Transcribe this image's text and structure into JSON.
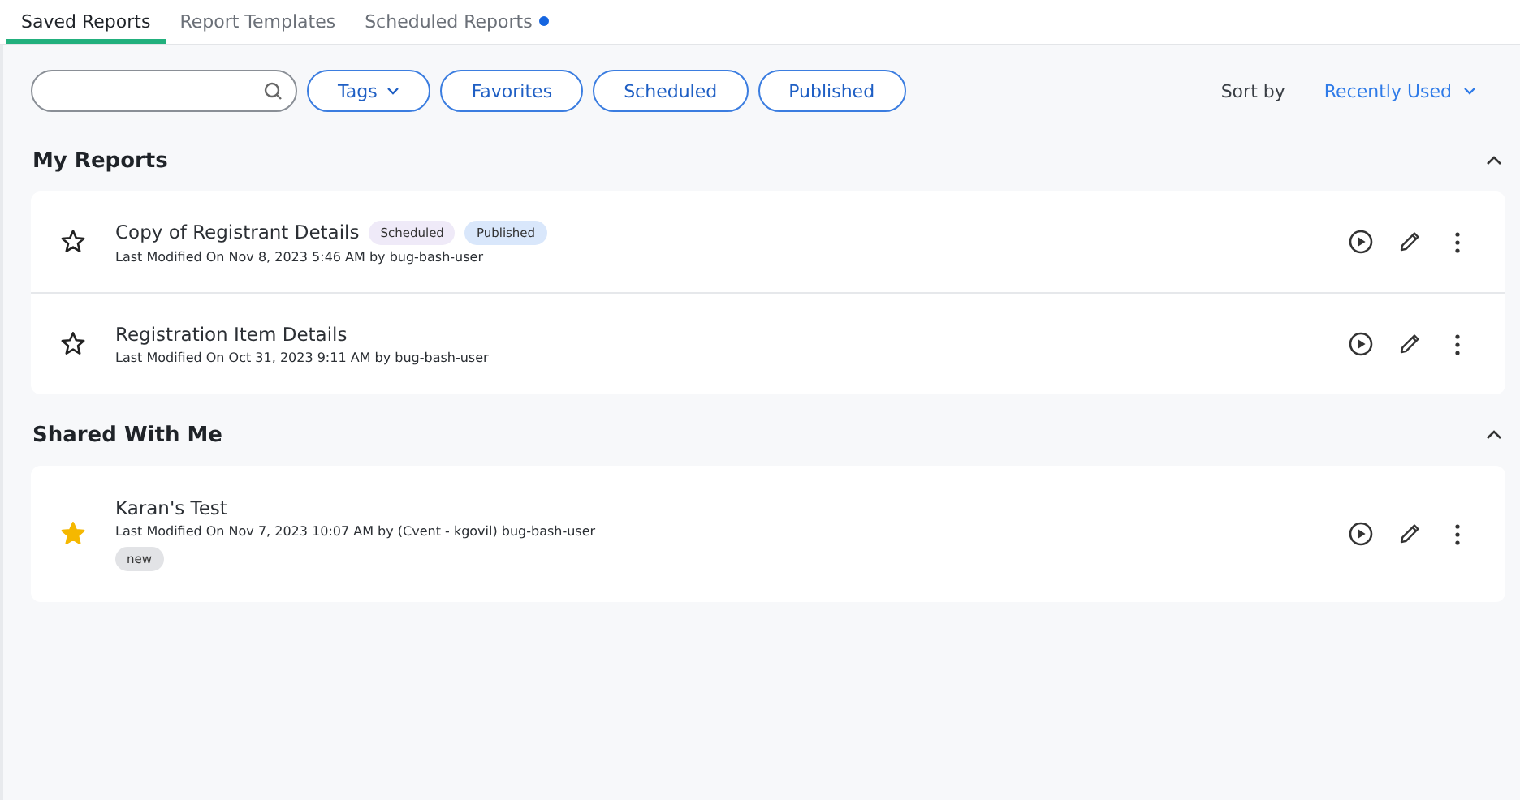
{
  "tabs": [
    {
      "label": "Saved Reports",
      "selected": true,
      "notification": false
    },
    {
      "label": "Report Templates",
      "selected": false,
      "notification": false
    },
    {
      "label": "Scheduled Reports",
      "selected": false,
      "notification": true
    }
  ],
  "filters": {
    "chips": [
      {
        "label": "Tags",
        "dropdown": true
      },
      {
        "label": "Favorites",
        "dropdown": false
      },
      {
        "label": "Scheduled",
        "dropdown": false
      },
      {
        "label": "Published",
        "dropdown": false
      }
    ],
    "sort_label": "Sort by",
    "sort_value": "Recently Used"
  },
  "sections": [
    {
      "title": "My Reports",
      "expanded": true,
      "reports": [
        {
          "name": "Copy of Registrant Details",
          "favorite": false,
          "modified": "Last Modified On Nov 8, 2023 5:46 AM by bug-bash-user",
          "tags": [
            {
              "label": "Scheduled",
              "kind": "scheduled"
            },
            {
              "label": "Published",
              "kind": "published"
            }
          ]
        },
        {
          "name": "Registration Item Details",
          "favorite": false,
          "modified": "Last Modified On Oct 31, 2023 9:11 AM by bug-bash-user"
        }
      ]
    },
    {
      "title": "Shared With Me",
      "expanded": true,
      "reports": [
        {
          "name": "Karan's Test",
          "favorite": true,
          "modified": "Last Modified On Nov 7, 2023 10:07 AM by (Cvent - kgovil) bug-bash-user",
          "badges": [
            {
              "label": "new",
              "kind": "new"
            }
          ]
        }
      ]
    }
  ]
}
